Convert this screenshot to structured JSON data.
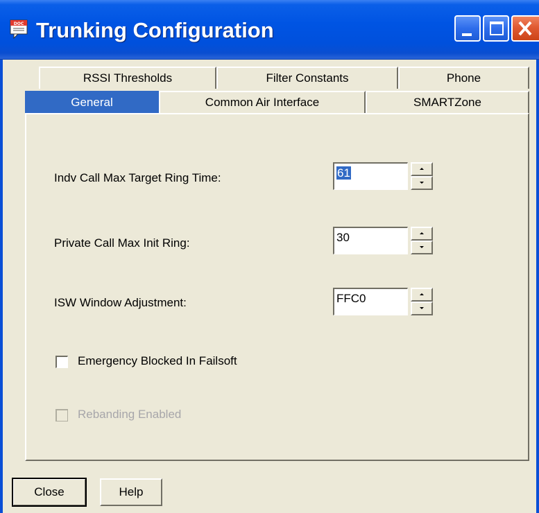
{
  "window": {
    "title": "Trunking Configuration",
    "icon": "doc-app-icon",
    "icon_text": "DOC",
    "controls": [
      "minimize",
      "maximize",
      "close"
    ]
  },
  "tabs": {
    "row1": [
      "RSSI Thresholds",
      "Filter Constants",
      "Phone"
    ],
    "row2": [
      "General",
      "Common Air Interface",
      "SMARTZone"
    ],
    "active": "General"
  },
  "form": {
    "indv_call": {
      "label": "Indv Call Max Target Ring Time:",
      "value": "61"
    },
    "private_call": {
      "label": "Private Call Max Init Ring:",
      "value": "30"
    },
    "isw_window": {
      "label": "ISW Window Adjustment:",
      "value": "FFC0"
    },
    "emergency": {
      "label": "Emergency Blocked In Failsoft",
      "checked": false
    },
    "rebanding": {
      "label": "Rebanding Enabled",
      "checked": false,
      "disabled": true
    }
  },
  "buttons": {
    "close": "Close",
    "help": "Help"
  }
}
